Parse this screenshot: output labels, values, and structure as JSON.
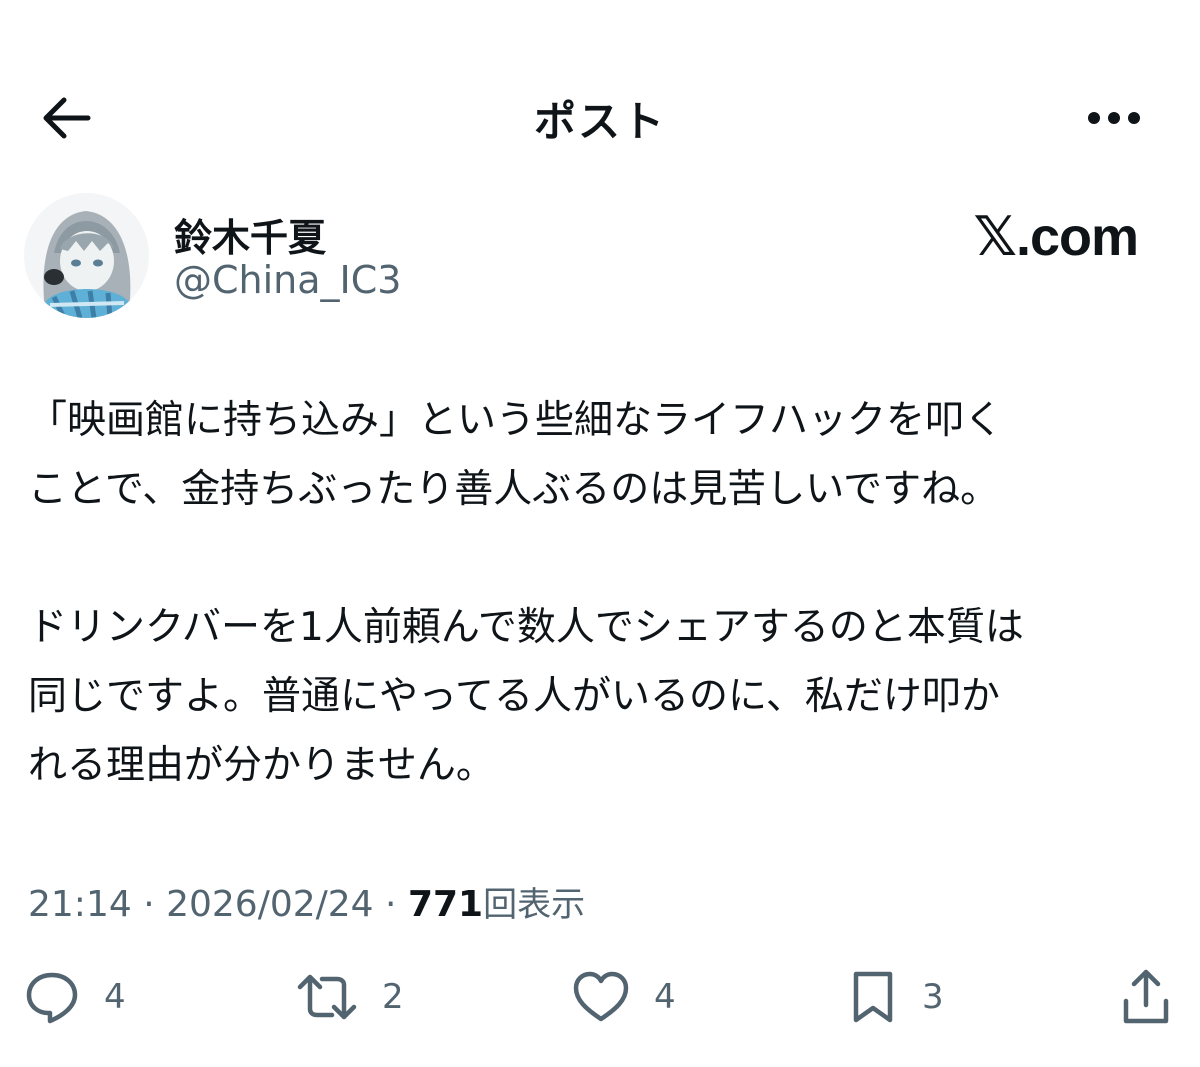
{
  "header": {
    "title": "ポスト",
    "back_icon": "arrow-left-icon",
    "more_icon": "more-horizontal-icon"
  },
  "author": {
    "display_name": "鈴木千夏",
    "handle": "@China_IC3"
  },
  "brand": {
    "mark": "𝕏",
    "text": ".com"
  },
  "post": {
    "paragraphs": [
      [
        "「映画館に持ち込み」という些細なライフハックを叩く",
        "ことで、金持ちぶったり善人ぶるのは見苦しいですね。"
      ],
      [
        "ドリンクバーを1人前頼んで数人でシェアするのと本質は",
        "同じですよ。普通にやってる人がいるのに、私だけ叩か",
        "れる理由が分かりません。"
      ]
    ]
  },
  "meta": {
    "time": "21:14",
    "separator": " · ",
    "date": "2026/02/24",
    "views_count": "771",
    "views_label": "回表示"
  },
  "actions": {
    "reply": {
      "icon": "reply-icon",
      "count": "4"
    },
    "repost": {
      "icon": "repost-icon",
      "count": "2"
    },
    "like": {
      "icon": "heart-icon",
      "count": "4"
    },
    "bookmark": {
      "icon": "bookmark-icon",
      "count": "3"
    },
    "share": {
      "icon": "share-icon"
    }
  },
  "colors": {
    "text": "#0f1419",
    "secondary": "#536471",
    "background": "#ffffff"
  }
}
